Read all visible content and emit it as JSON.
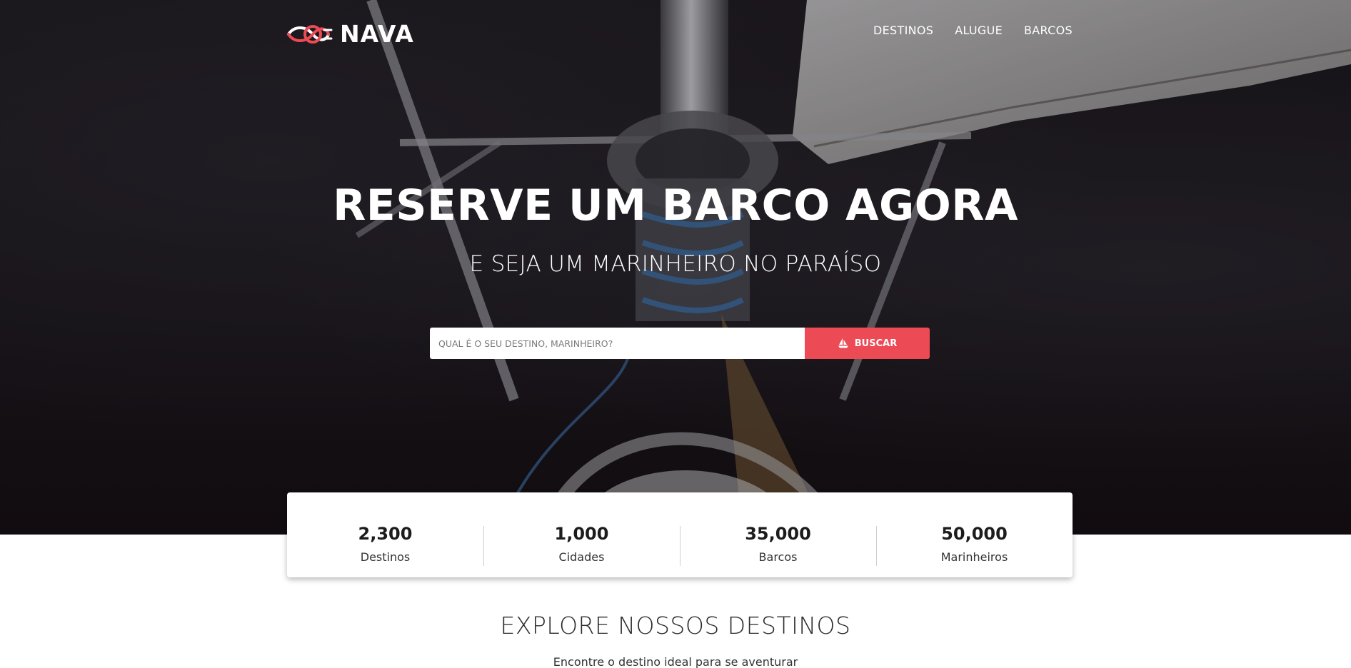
{
  "brand": {
    "name": "NAVA",
    "accent": "#ec4a55"
  },
  "nav": {
    "items": [
      {
        "label": "DESTINOS"
      },
      {
        "label": "ALUGUE"
      },
      {
        "label": "BARCOS"
      }
    ]
  },
  "hero": {
    "title": "RESERVE UM BARCO AGORA",
    "subtitle": "E SEJA UM MARINHEIRO NO PARAÍSO"
  },
  "search": {
    "placeholder": "QUAL É O SEU DESTINO, MARINHEIRO?",
    "value": "",
    "button_label": "BUSCAR",
    "button_icon": "boat-icon"
  },
  "stats": [
    {
      "value": "2,300",
      "label": "Destinos"
    },
    {
      "value": "1,000",
      "label": "Cidades"
    },
    {
      "value": "35,000",
      "label": "Barcos"
    },
    {
      "value": "50,000",
      "label": "Marinheiros"
    }
  ],
  "explore": {
    "title": "EXPLORE NOSSOS DESTINOS",
    "subtitle": "Encontre o destino ideal para se aventurar"
  }
}
